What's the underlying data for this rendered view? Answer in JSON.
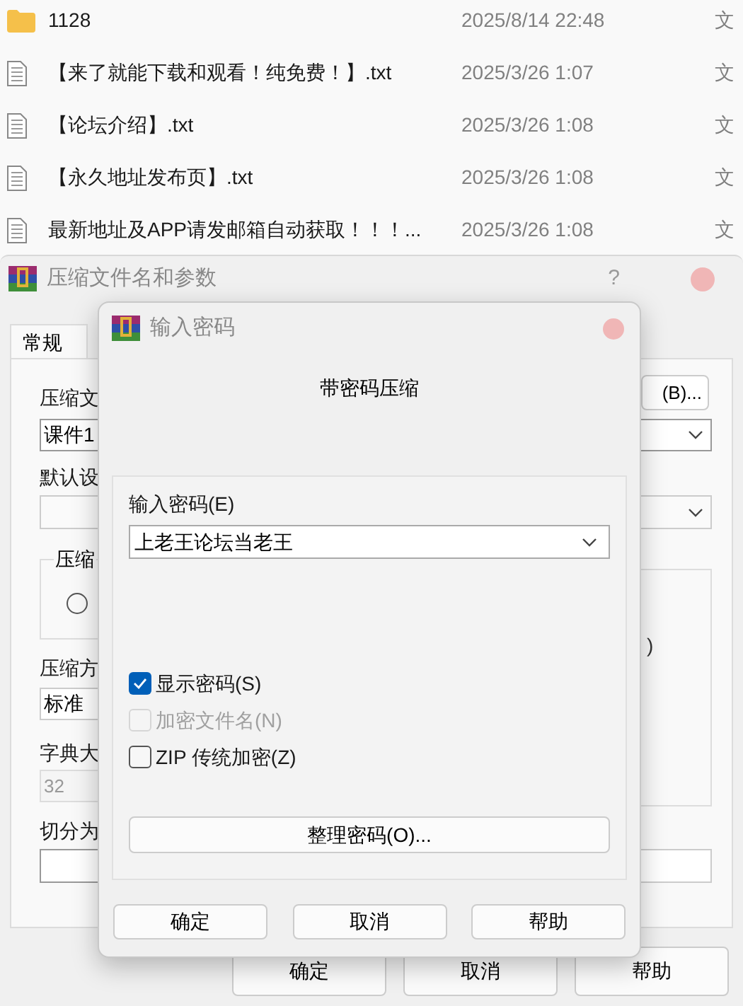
{
  "file_list": {
    "rows": [
      {
        "kind": "folder",
        "name": "1128",
        "modified": "2025/8/14 22:48",
        "type": "文"
      },
      {
        "kind": "text",
        "name": "【来了就能下载和观看！纯免费！】.txt",
        "modified": "2025/3/26 1:07",
        "type": "文"
      },
      {
        "kind": "text",
        "name": "【论坛介绍】.txt",
        "modified": "2025/3/26 1:08",
        "type": "文"
      },
      {
        "kind": "text",
        "name": "【永久地址发布页】.txt",
        "modified": "2025/3/26 1:08",
        "type": "文"
      },
      {
        "kind": "text",
        "name": "最新地址及APP请发邮箱自动获取！！！...",
        "modified": "2025/3/26 1:08",
        "type": "文"
      }
    ]
  },
  "archive_dialog": {
    "title": "压缩文件名和参数",
    "help": "?",
    "tabs": [
      {
        "label": "常规",
        "selected": true
      }
    ],
    "archive_name_label": "压缩文",
    "browse_button": "(B)...",
    "archive_name_value": "课件1",
    "profile_label": "默认设",
    "group_label": "压缩",
    "radio": {
      "selected": false
    },
    "group_fragment": ")",
    "method_label": "压缩方",
    "method_value": "标准",
    "dictionary_label": "字典大",
    "dictionary_value": "32",
    "split_label": "切分为",
    "buttons": [
      "确定",
      "取消",
      "帮助"
    ]
  },
  "password_dialog": {
    "title": "输入密码",
    "heading": "带密码压缩",
    "password_label": "输入密码(E)",
    "password_value": "上老王论坛当老王",
    "options": [
      {
        "label": "显示密码(S)",
        "checked": true,
        "disabled": false
      },
      {
        "label": "加密文件名(N)",
        "checked": false,
        "disabled": true
      },
      {
        "label": "ZIP 传统加密(Z)",
        "checked": false,
        "disabled": false
      }
    ],
    "manage_button": "整理密码(O)...",
    "buttons": [
      "确定",
      "取消",
      "帮助"
    ]
  }
}
